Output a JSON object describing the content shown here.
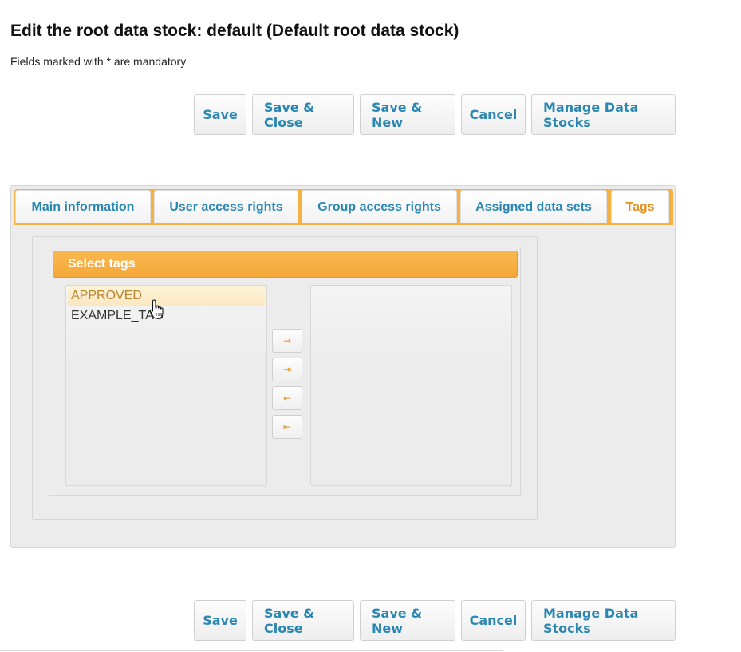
{
  "page": {
    "title": "Edit the root data stock: default (Default root data stock)",
    "mandatory_note": "Fields marked with * are mandatory"
  },
  "toolbar": {
    "save": "Save",
    "save_close": "Save & Close",
    "save_new": "Save & New",
    "cancel": "Cancel",
    "manage": "Manage Data Stocks"
  },
  "tabs": [
    {
      "label": "Main information"
    },
    {
      "label": "User access rights"
    },
    {
      "label": "Group access rights"
    },
    {
      "label": "Assigned data sets"
    },
    {
      "label": "Tags",
      "active": true
    }
  ],
  "picklist": {
    "header": "Select tags",
    "source_items": [
      "APPROVED",
      "EXAMPLE_TAG"
    ],
    "target_items": [],
    "buttons": {
      "add": "→",
      "add_all": "⇥",
      "remove": "←",
      "remove_all": "⇤"
    }
  },
  "colors": {
    "accent": "#f7b042",
    "link_blue": "#2a87b2",
    "active_tab": "#e8901a"
  }
}
